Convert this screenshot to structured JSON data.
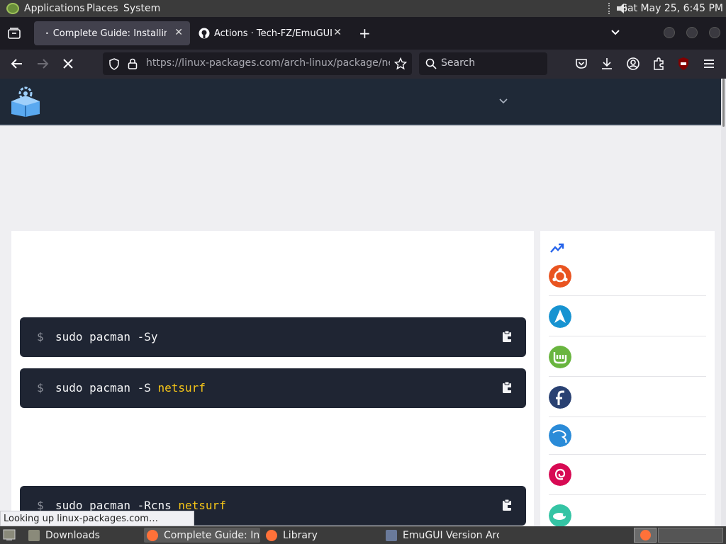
{
  "system_panel": {
    "menus": [
      "Applications",
      "Places",
      "System"
    ],
    "clock": "Sat May 25,  6:45 PM"
  },
  "browser": {
    "tabs": [
      {
        "title": "Complete Guide: Installing",
        "active": true
      },
      {
        "title": "Actions · Tech-FZ/EmuGUI",
        "active": false
      }
    ],
    "url_host": "https://linux-packages.com",
    "url_path": "/arch-linux/package/netsurf",
    "search_placeholder": "Search"
  },
  "page": {
    "commands": [
      {
        "prompt": "$",
        "cmd": "sudo pacman -Sy",
        "pkg": ""
      },
      {
        "prompt": "$",
        "cmd": "sudo pacman -S ",
        "pkg": "netsurf"
      },
      {
        "prompt": "$",
        "cmd": "sudo pacman -Rcns ",
        "pkg": "netsurf"
      }
    ],
    "sidebar_distros": [
      "ubuntu-icon",
      "arch-icon",
      "linux-mint-icon",
      "fedora-icon",
      "kali-icon",
      "debian-icon",
      "opensuse-icon"
    ]
  },
  "status_text": "Looking up linux-packages.com…",
  "taskbar": {
    "items": [
      {
        "label": "Downloads",
        "active": false
      },
      {
        "label": "Complete Guide: In…",
        "active": true
      },
      {
        "label": "Library",
        "active": false
      },
      {
        "label": "EmuGUI Version Arc…",
        "active": false
      }
    ]
  },
  "colors": {
    "header_bg": "#1f2937",
    "code_bg": "#1f2533",
    "package_highlight": "#f5c518",
    "trending_blue": "#2563eb"
  }
}
